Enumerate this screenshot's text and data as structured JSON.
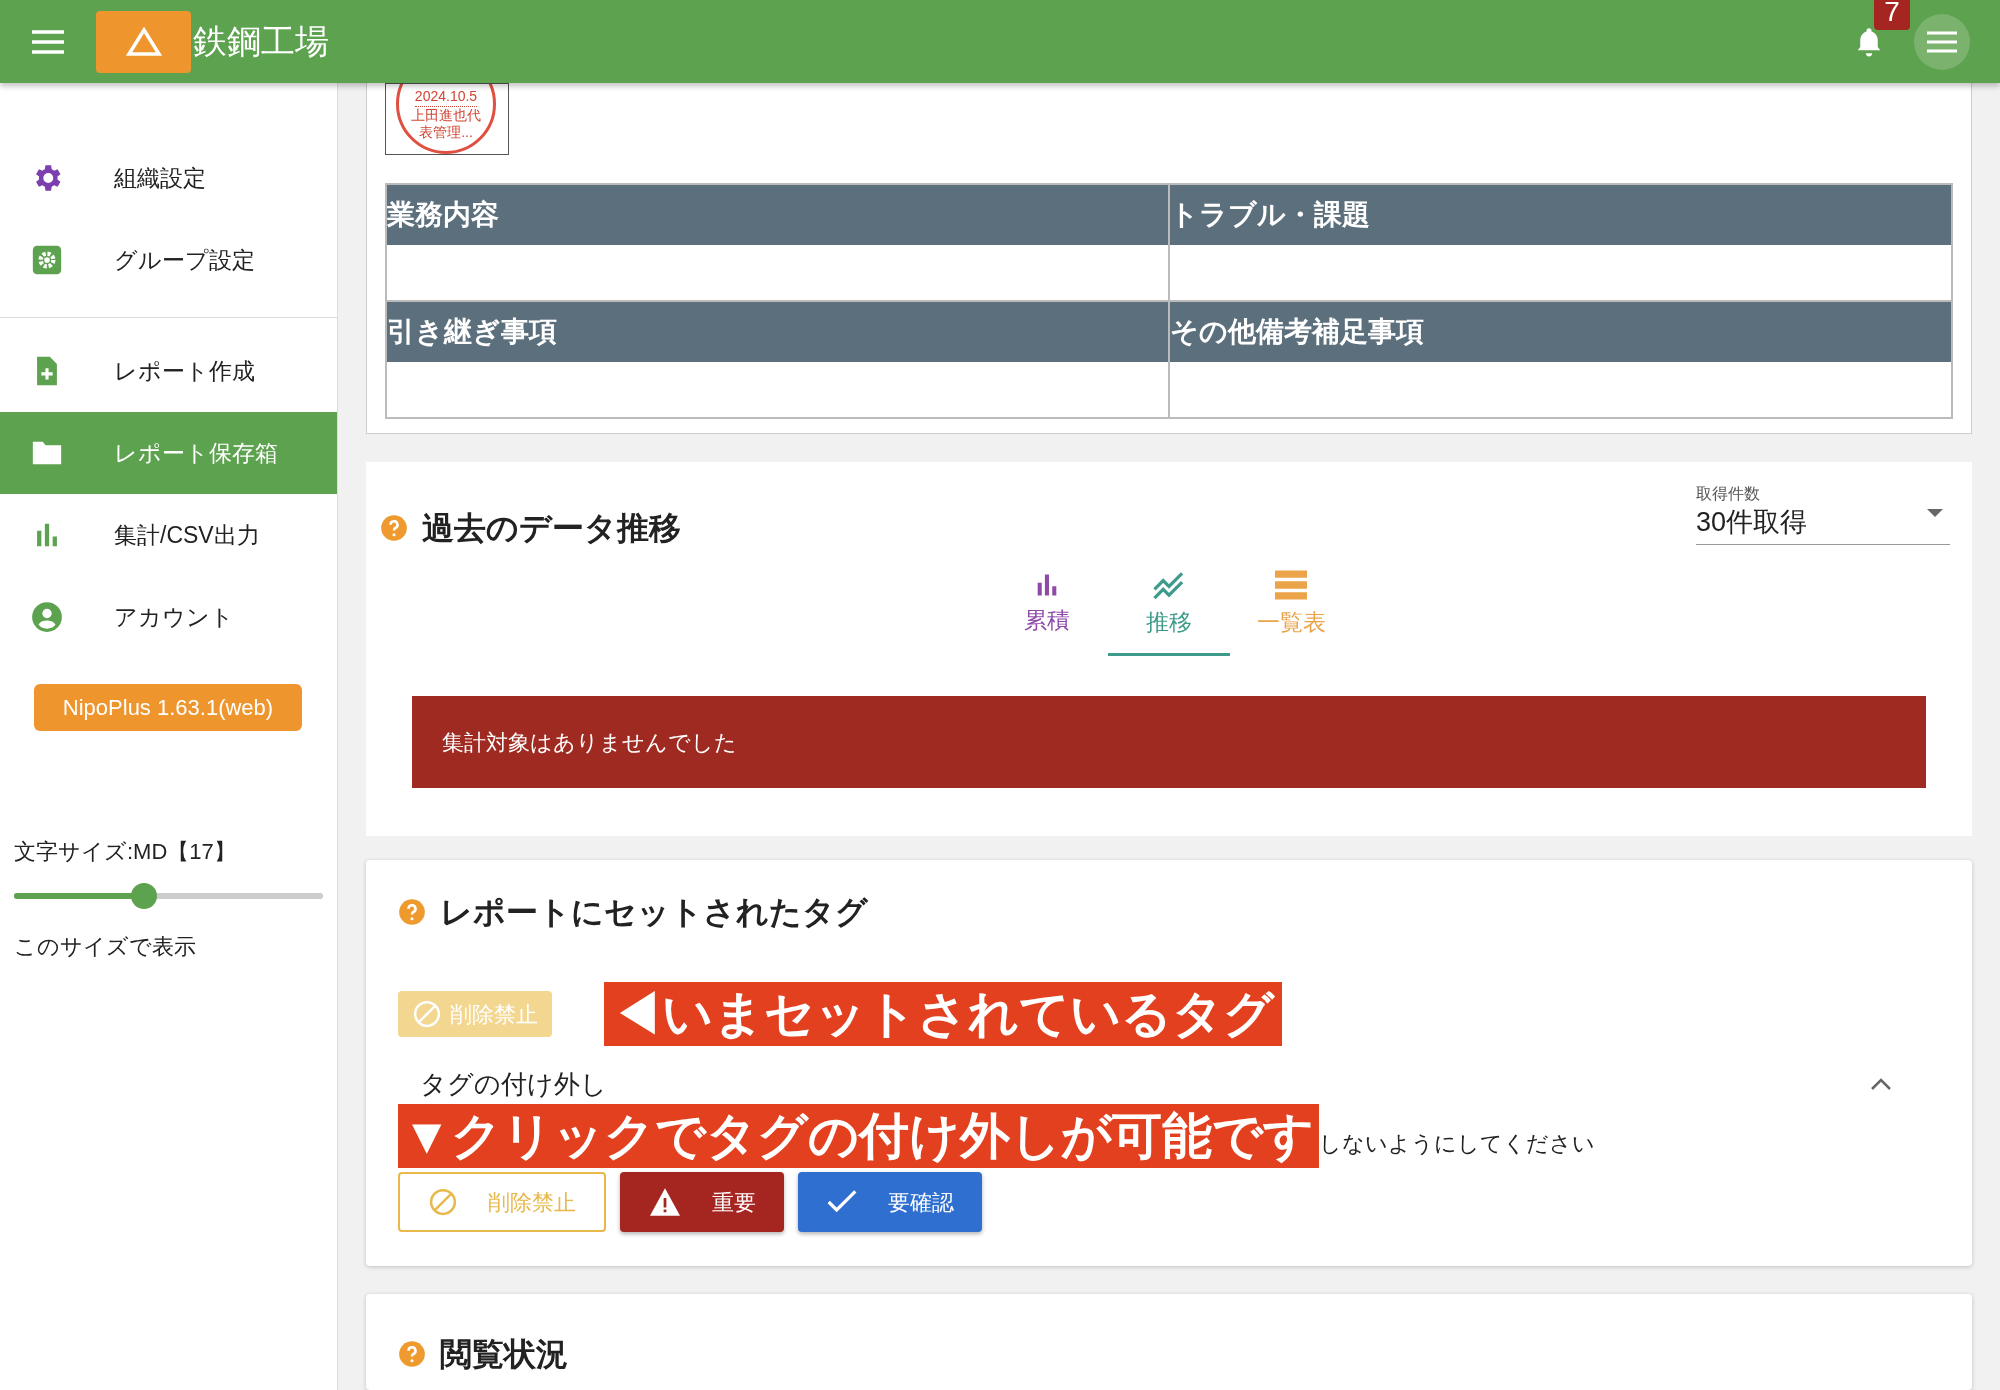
{
  "header": {
    "title": "鉄鋼工場",
    "notification_count": "7"
  },
  "sidebar": {
    "sections": [
      {
        "items": [
          {
            "label": "組織設定",
            "kind": "gear",
            "selected": false
          },
          {
            "label": "グループ設定",
            "kind": "gearbox",
            "selected": false
          }
        ]
      },
      {
        "items": [
          {
            "label": "レポート作成",
            "kind": "newdoc",
            "selected": false
          },
          {
            "label": "レポート保存箱",
            "kind": "folder",
            "selected": true
          },
          {
            "label": "集計/CSV出力",
            "kind": "bars",
            "selected": false
          },
          {
            "label": "アカウント",
            "kind": "account",
            "selected": false
          }
        ]
      }
    ],
    "version": "NipoPlus 1.63.1(web)",
    "font_size": {
      "label": "文字サイズ:MD【17】",
      "level": 0.42,
      "apply": "このサイズで表示"
    }
  },
  "report": {
    "stamp": {
      "date": "2024.10.5",
      "name": "上田進也代表管理..."
    },
    "fields": [
      {
        "label": "業務内容"
      },
      {
        "label": "トラブル・課題"
      },
      {
        "label": "引き継ぎ事項"
      },
      {
        "label": "その他備考補足事項"
      }
    ]
  },
  "history": {
    "title": "過去のデータ推移",
    "count_select": {
      "label": "取得件数",
      "value": "30件取得"
    },
    "tabs": [
      {
        "label": "累積",
        "kind": "bars",
        "color": "#8e4aa8",
        "selected": false
      },
      {
        "label": "推移",
        "kind": "trend",
        "color": "#3e9a8a",
        "selected": true
      },
      {
        "label": "一覧表",
        "kind": "list",
        "color": "#eba44a",
        "selected": false
      }
    ],
    "message": "集計対象はありませんでした"
  },
  "tags": {
    "title": "レポートにセットされたタグ",
    "current": [
      {
        "label": "削除禁止",
        "kind": "prohibit"
      }
    ],
    "callout_current": "◀いまセットされているタグ",
    "toggle": {
      "label": "タグの付け外し",
      "expanded": true
    },
    "callout_toggle": "▼クリックでタグの付け外しが可能です",
    "note": "しないようにしてください",
    "buttons": [
      {
        "label": "削除禁止",
        "kind": "prohibit",
        "outlined": true,
        "color": "#e8b84a"
      },
      {
        "label": "重要",
        "kind": "warning",
        "outlined": false,
        "color": "#a52521"
      },
      {
        "label": "要確認",
        "kind": "check",
        "outlined": false,
        "color": "#2f6fcf"
      }
    ]
  },
  "views": {
    "title": "閲覧状況"
  }
}
